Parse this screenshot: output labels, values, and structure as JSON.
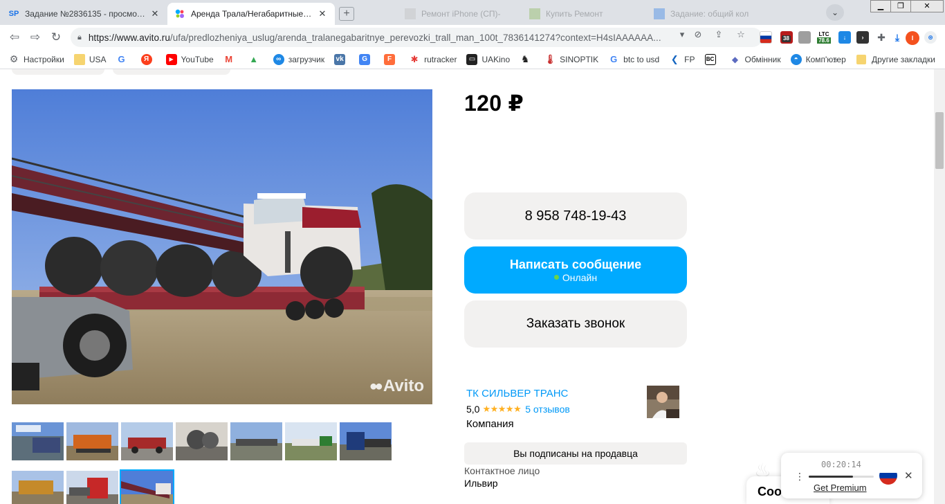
{
  "browser": {
    "tabs": [
      {
        "title": "Задание №2836135 - просмотр з",
        "favicon": "SP",
        "active": false
      },
      {
        "title": "Аренда Трала/Негабаритные пер",
        "favicon": "avito",
        "active": true
      },
      {
        "title": "Ремонт iPhone (СП)-",
        "active": false
      },
      {
        "title": "Купить Ремонт",
        "active": false
      },
      {
        "title": "Задание: общий кол",
        "active": false
      }
    ],
    "new_tab": "+",
    "url_main": "https://www.avito.ru",
    "url_rest": "/ufa/predlozheniya_uslug/arenda_tralanegabaritnye_perevozki_trall_man_100t_7836141274?context=H4sIAAAAAA...",
    "ext_badges": {
      "red": "38",
      "ltc": "LTC",
      "ltc_value": "78.6",
      "profile": "I"
    }
  },
  "bookmarks": [
    {
      "label": "Настройки",
      "icon": "gear-icon"
    },
    {
      "label": "USA",
      "icon": "folder-icon"
    },
    {
      "label": "",
      "icon": "google-icon"
    },
    {
      "label": "",
      "icon": "yandex-icon"
    },
    {
      "label": "YouTube",
      "icon": "youtube-icon"
    },
    {
      "label": "",
      "icon": "gmail-icon"
    },
    {
      "label": "",
      "icon": "drive-icon"
    },
    {
      "label": "загрузчик",
      "icon": "loop-icon"
    },
    {
      "label": "",
      "icon": "vk-icon"
    },
    {
      "label": "",
      "icon": "translate-icon"
    },
    {
      "label": "",
      "icon": "fl-icon"
    },
    {
      "label": "rutracker",
      "icon": "rutracker-icon"
    },
    {
      "label": "UAKino",
      "icon": "uakino-icon"
    },
    {
      "label": "",
      "icon": "chess-icon"
    },
    {
      "label": "SINOPTIK",
      "icon": "thermometer-icon"
    },
    {
      "label": "btc to usd",
      "icon": "google-icon"
    },
    {
      "label": "FP",
      "icon": "fp-icon"
    },
    {
      "label": "",
      "icon": "bc-icon"
    },
    {
      "label": "Обмінник",
      "icon": "exchange-icon"
    },
    {
      "label": "Комп'ютер",
      "icon": "computer-icon"
    },
    {
      "label": "",
      "icon": "sparkle-icon"
    }
  ],
  "bookmarks_more": "»",
  "bookmarks_other": "Другие закладки",
  "listing": {
    "price": "120 ₽",
    "phone": "8 958 748-19-43",
    "message_button": "Написать сообщение",
    "online": "Онлайн",
    "callback_button": "Заказать звонок",
    "seller": {
      "name": "ТК СИЛЬВЕР ТРАНС",
      "rating": "5,0",
      "stars": "★★★★★",
      "reviews": "5 отзывов",
      "type": "Компания"
    },
    "subscribed": "Вы подписаны на продавца",
    "contact_label": "Контактное лицо",
    "contact_name": "Ильвир",
    "watermark": "Avito",
    "thumbnails_count": 10
  },
  "chat_peek": "Соо",
  "media_widget": {
    "time": "00:20:14",
    "progress": 0.68,
    "link": "Get Premium",
    "close": "✕"
  },
  "colors": {
    "accent": "#00aaff",
    "link": "#0099f7",
    "star": "#ffb021",
    "online": "#6ad34a"
  }
}
